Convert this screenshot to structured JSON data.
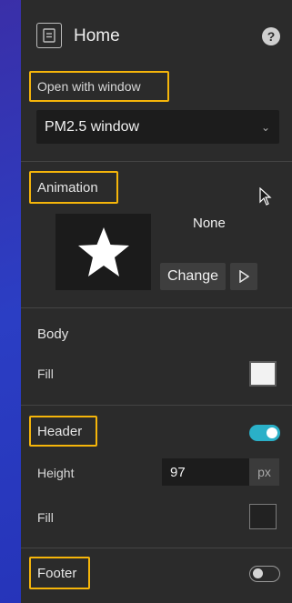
{
  "header": {
    "title": "Home",
    "icon": "page-icon",
    "help_glyph": "?"
  },
  "open_with_window": {
    "label": "Open with window",
    "selected": "PM2.5 window",
    "chevron": "⌄"
  },
  "animation": {
    "label": "Animation",
    "current": "None",
    "change_label": "Change",
    "preview_icon": "star-icon"
  },
  "body": {
    "label": "Body",
    "fill_label": "Fill",
    "fill_color": "#f2f2f2"
  },
  "header_section": {
    "label": "Header",
    "enabled": true,
    "height_label": "Height",
    "height_value": "97",
    "height_unit": "px",
    "fill_label": "Fill",
    "fill_color": "#222222"
  },
  "footer": {
    "label": "Footer",
    "enabled": false
  },
  "colors": {
    "highlight": "#f5b50a",
    "toggle_on": "#2ab0c8",
    "panel_bg": "#2b2b2b"
  }
}
